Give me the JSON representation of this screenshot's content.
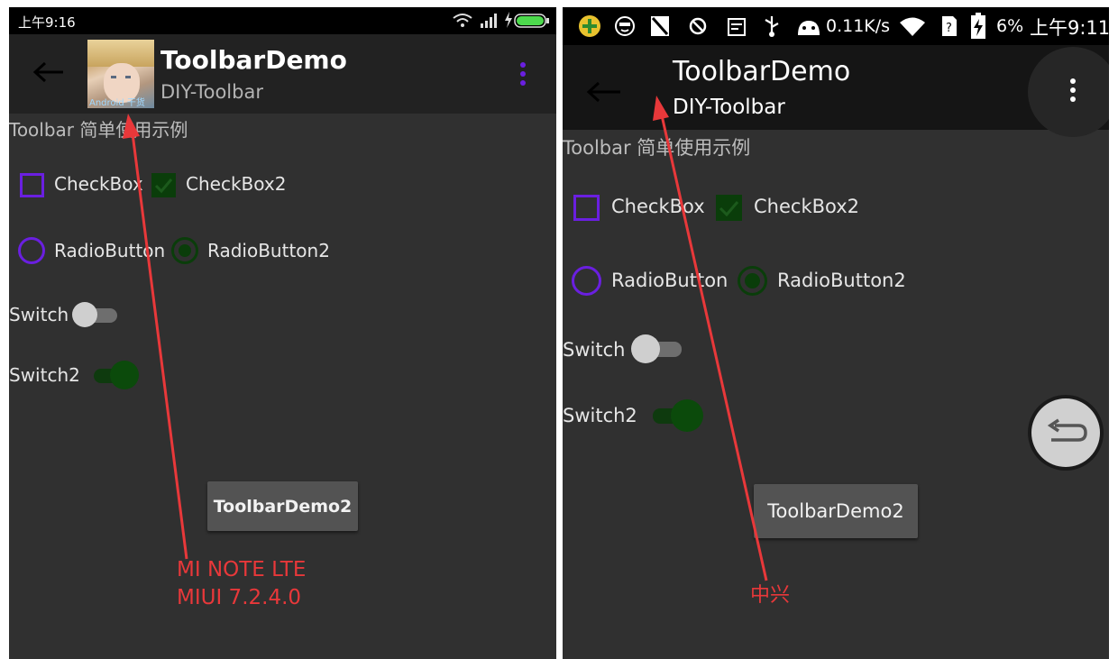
{
  "left_phone": {
    "status": {
      "time": "上午9:16"
    },
    "toolbar": {
      "title": "ToolbarDemo",
      "subtitle": "DIY-Toolbar",
      "logo_watermark": "Android 干货"
    },
    "content": {
      "heading": "Toolbar 简单使用示例",
      "checkbox1": "CheckBox",
      "checkbox2": "CheckBox2",
      "radio1": "RadioButton",
      "radio2": "RadioButton2",
      "switch1": "Switch",
      "switch2": "Switch2",
      "button": "ToolbarDemo2"
    },
    "annotation": {
      "line1": "MI NOTE LTE",
      "line2": "MIUI 7.2.4.0"
    }
  },
  "right_phone": {
    "status": {
      "speed": "0.11K/s",
      "battery": "6%",
      "time": "上午9:11"
    },
    "toolbar": {
      "title": "ToolbarDemo",
      "subtitle": "DIY-Toolbar"
    },
    "content": {
      "heading": "Toolbar 简单使用示例",
      "checkbox1": "CheckBox",
      "checkbox2": "CheckBox2",
      "radio1": "RadioButton",
      "radio2": "RadioButton2",
      "switch1": "Switch",
      "switch2": "Switch2",
      "button": "ToolbarDemo2"
    },
    "annotation": {
      "label": "中兴"
    }
  },
  "colors": {
    "accent_purple": "#6a1fe0",
    "checked_green": "#0a3d0a",
    "annotation_red": "#e8383a"
  },
  "icons": [
    "back-arrow-icon",
    "overflow-menu-icon",
    "wifi-icon",
    "signal-icon",
    "battery-icon",
    "usb-icon",
    "android-icon",
    "back-float-icon"
  ]
}
